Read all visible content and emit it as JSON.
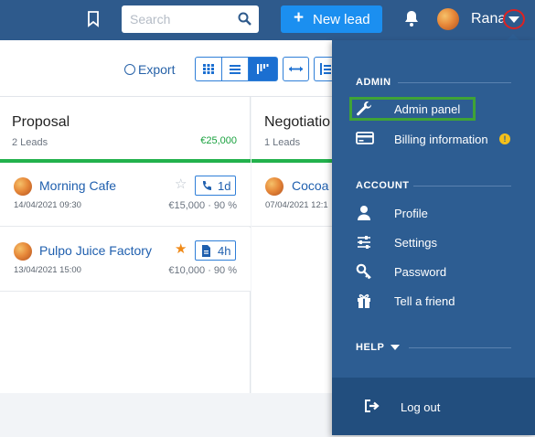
{
  "topbar": {
    "search_placeholder": "Search",
    "new_lead_label": "New lead",
    "user_name": "Rana"
  },
  "toolbar": {
    "export_label": "Export"
  },
  "columns": [
    {
      "title": "Proposal",
      "count": "2 Leads",
      "amount": "€25,000",
      "cards": [
        {
          "name": "Morning Cafe",
          "date": "14/04/2021 09:30",
          "amount": "€15,000 · 90 %",
          "badge": "1d",
          "starred": false
        },
        {
          "name": "Pulpo Juice Factory",
          "date": "13/04/2021 15:00",
          "amount": "€10,000 · 90 %",
          "badge": "4h",
          "starred": true
        }
      ]
    },
    {
      "title": "Negotiatio",
      "count": "1 Leads",
      "cards": [
        {
          "name": "Cocoa",
          "date": "07/04/2021 12:1"
        }
      ]
    }
  ],
  "menu": {
    "admin_header": "ADMIN",
    "admin_panel": "Admin panel",
    "billing": "Billing information",
    "billing_alert": "!",
    "account_header": "ACCOUNT",
    "profile": "Profile",
    "settings": "Settings",
    "password": "Password",
    "tell_friend": "Tell a friend",
    "help_header": "HELP",
    "logout": "Log out"
  },
  "colors": {
    "topbar": "#2e5a8c",
    "accent_button": "#1b8ff0",
    "menu_bg": "#2d5d92",
    "stage_bar": "#22b14c",
    "highlight_admin": "#3fa336",
    "highlight_caret": "#dd2222"
  },
  "icons": [
    "bookmark-icon",
    "search-icon",
    "plus-icon",
    "bell-icon",
    "caret-down-icon",
    "export-icon",
    "grid-view-icon",
    "list-view-icon",
    "pipeline-view-icon",
    "expand-icon",
    "sort-icon",
    "star-icon",
    "phone-icon",
    "document-icon",
    "wrench-icon",
    "credit-card-icon",
    "person-icon",
    "sliders-icon",
    "key-icon",
    "gift-icon",
    "logout-icon"
  ]
}
